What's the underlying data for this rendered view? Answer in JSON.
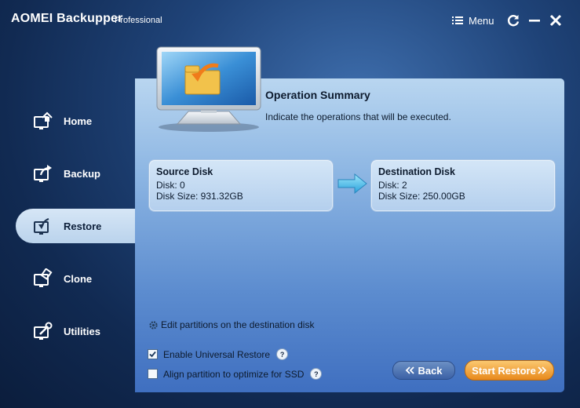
{
  "titlebar": {
    "app_title": "AOMEI Backupper",
    "edition": "Professional",
    "menu_label": "Menu"
  },
  "sidebar": {
    "items": [
      {
        "label": "Home",
        "icon": "home-icon",
        "active": false
      },
      {
        "label": "Backup",
        "icon": "backup-icon",
        "active": false
      },
      {
        "label": "Restore",
        "icon": "restore-icon",
        "active": true
      },
      {
        "label": "Clone",
        "icon": "clone-icon",
        "active": false
      },
      {
        "label": "Utilities",
        "icon": "utilities-icon",
        "active": false
      }
    ]
  },
  "summary": {
    "title": "Operation Summary",
    "subtitle": "Indicate the operations that will be executed."
  },
  "source_disk": {
    "title": "Source Disk",
    "disk": "Disk: 0",
    "size": "Disk Size: 931.32GB"
  },
  "destination_disk": {
    "title": "Destination Disk",
    "disk": "Disk: 2",
    "size": "Disk Size: 250.00GB"
  },
  "options": {
    "edit_partitions": "Edit partitions on the destination disk",
    "universal_restore": {
      "label": "Enable Universal Restore",
      "checked": true
    },
    "align_ssd": {
      "label": "Align partition to optimize for SSD",
      "checked": false
    },
    "help_glyph": "?"
  },
  "buttons": {
    "back": "Back",
    "start": "Start Restore"
  },
  "colors": {
    "accent_orange": "#e8891c",
    "back_blue": "#3c62a6",
    "panel_light": "#b9d6f0"
  }
}
